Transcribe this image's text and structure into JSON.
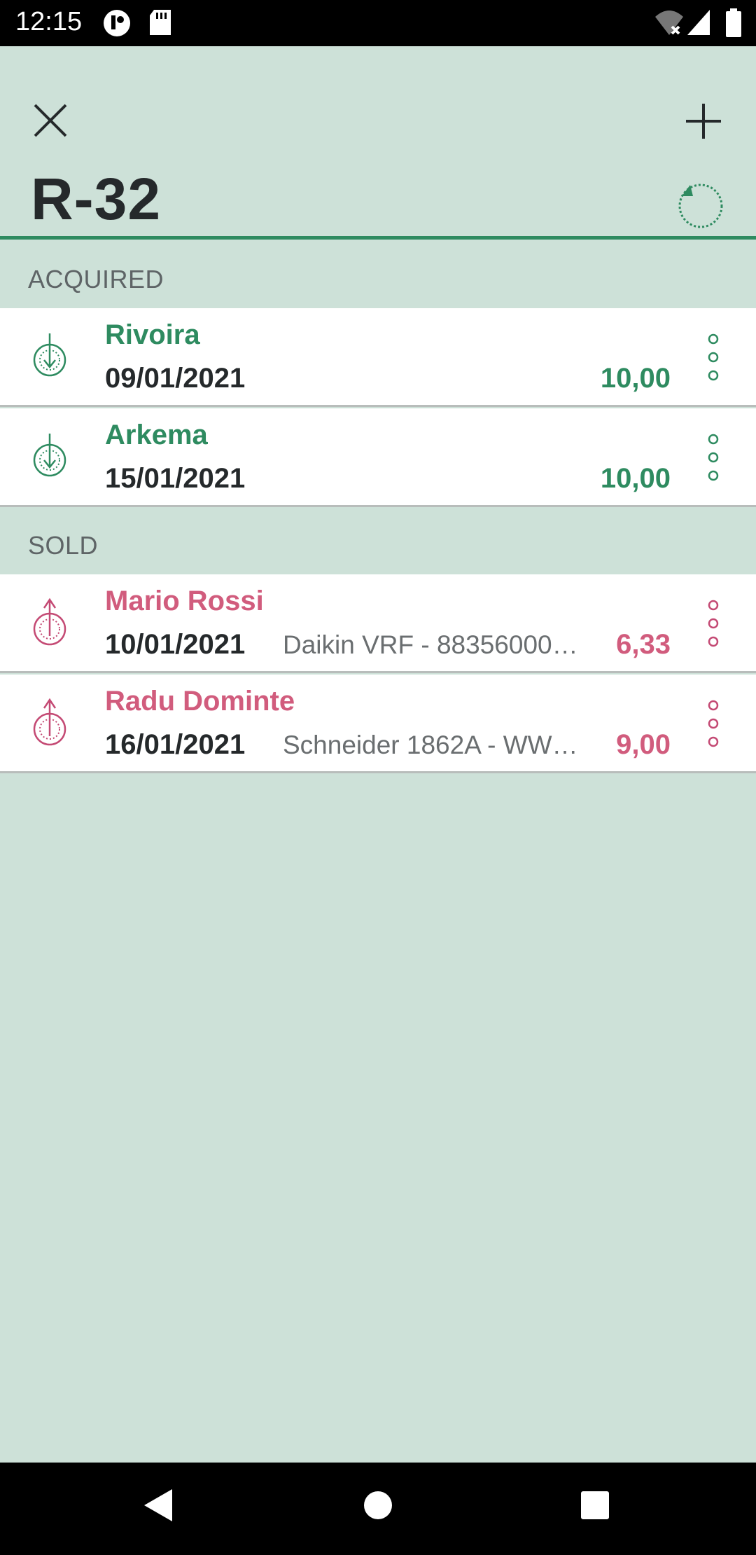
{
  "status_bar": {
    "time": "12:15",
    "icons": [
      "app-notification-icon",
      "sd-card-icon",
      "wifi-off-icon",
      "signal-icon",
      "battery-icon"
    ]
  },
  "app_bar": {
    "title": "R-32",
    "close_icon": "close-icon",
    "add_icon": "plus-icon",
    "refresh_icon": "refresh-icon"
  },
  "colors": {
    "background": "#cde1d8",
    "accent_green": "#2e8b60",
    "accent_pink": "#d15c7d",
    "title_text": "#25292b"
  },
  "acquired": {
    "header": "ACQUIRED",
    "items": [
      {
        "name": "Rivoira",
        "date": "09/01/2021",
        "note": "",
        "amount": "10,00"
      },
      {
        "name": "Arkema",
        "date": "15/01/2021",
        "note": "",
        "amount": "10,00"
      }
    ]
  },
  "sold": {
    "header": "SOLD",
    "items": [
      {
        "name": "Mario Rossi",
        "date": "10/01/2021",
        "note": "Daikin VRF - 88356000…",
        "amount": "6,33"
      },
      {
        "name": "Radu Dominte",
        "date": "16/01/2021",
        "note": "Schneider 1862A - WW…",
        "amount": "9,00"
      }
    ]
  },
  "nav_bar": {
    "icons": [
      "back-icon",
      "home-icon",
      "recents-icon"
    ]
  }
}
